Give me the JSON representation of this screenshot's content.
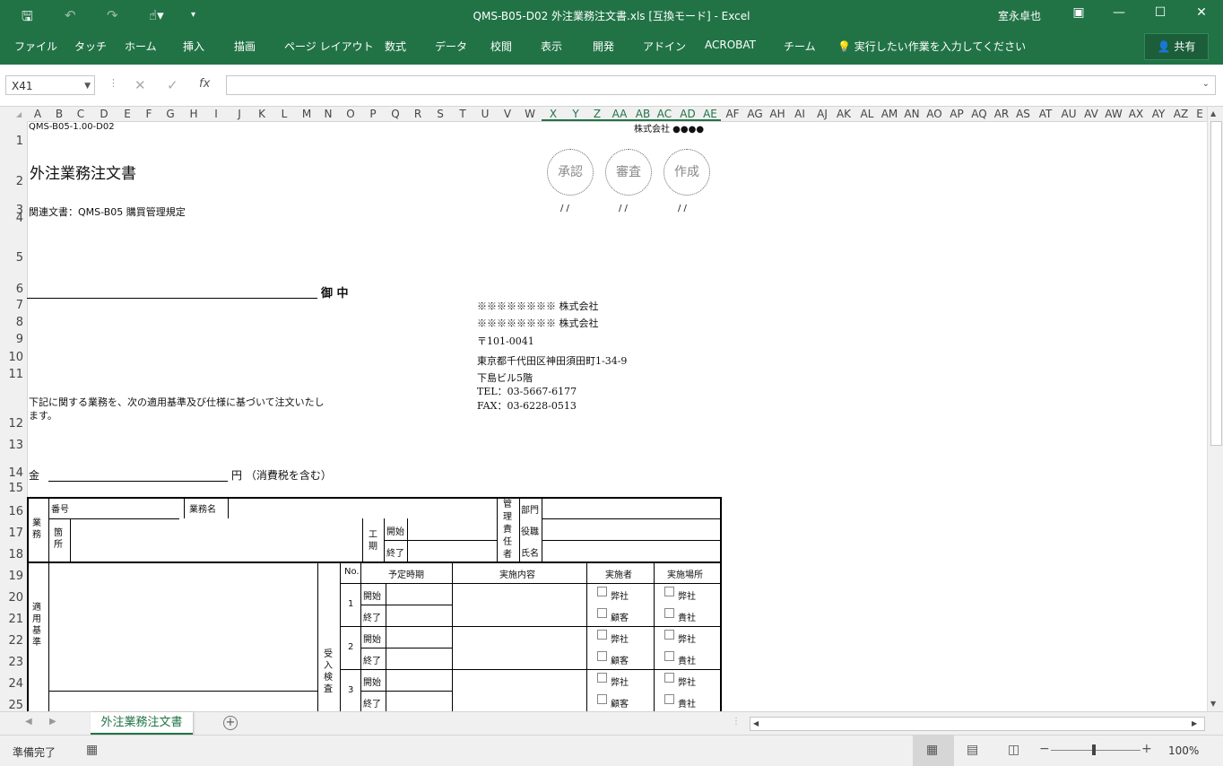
{
  "window": {
    "title": "QMS-B05-D02 外注業務注文書.xls  [互換モード] - Excel",
    "user": "室永卓也"
  },
  "quick_access": [
    "save-icon",
    "undo-icon",
    "redo-icon",
    "touch-mode-icon",
    "customize-icon"
  ],
  "ribbon": {
    "tabs": [
      "ファイル",
      "タッチ",
      "ホーム",
      "挿入",
      "描画",
      "ページ レイアウト",
      "数式",
      "データ",
      "校閲",
      "表示",
      "開発",
      "アドイン",
      "ACROBAT",
      "チーム"
    ],
    "tell_me": "実行したい作業を入力してください",
    "share": "共有"
  },
  "formula_bar": {
    "name_box": "X41",
    "formula": "",
    "fx_label": "fx"
  },
  "columns": [
    "A",
    "B",
    "C",
    "D",
    "E",
    "F",
    "G",
    "H",
    "I",
    "J",
    "K",
    "L",
    "M",
    "N",
    "O",
    "P",
    "Q",
    "R",
    "S",
    "T",
    "U",
    "V",
    "W",
    "X",
    "Y",
    "Z",
    "AA",
    "AB",
    "AC",
    "AD",
    "AE",
    "AF",
    "AG",
    "AH",
    "AI",
    "AJ",
    "AK",
    "AL",
    "AM",
    "AN",
    "AO",
    "AP",
    "AQ",
    "AR",
    "AS",
    "AT",
    "AU",
    "AV",
    "AW",
    "AX",
    "AY",
    "AZ",
    "E"
  ],
  "rows": [
    "1",
    "2",
    "3",
    "4",
    "5",
    "6",
    "7",
    "8",
    "9",
    "10",
    "11",
    "12",
    "13",
    "14",
    "15",
    "16",
    "17",
    "18",
    "19",
    "20",
    "21",
    "22",
    "23",
    "24",
    "25"
  ],
  "doc": {
    "code": "QMS-B05-1.00-D02",
    "company_top": "株式会社 ●●●●",
    "title": "外注業務注文書",
    "related": "関連文書：QMS-B05 購買管理規定",
    "seals": [
      "承認",
      "審査",
      "作成"
    ],
    "seal_date": "/  /",
    "onchu": "御 中",
    "sender": {
      "company1": "※※※※※※※※ 株式会社",
      "company2": "※※※※※※※※ 株式会社",
      "postal": "〒101-0041",
      "address": "東京都千代田区神田須田町1-34-9",
      "building": "下島ビル5階",
      "tel": "TEL：03-5667-6177",
      "fax": "FAX：03-6228-0513"
    },
    "intro1": "下記に関する業務を、次の適用基準及び仕様に基づいて注文いたし",
    "intro2": "ます。",
    "amount_prefix": "金",
    "amount_suffix": "円 （消費税を含む）",
    "table": {
      "gyomu": "業務",
      "bango": "番号",
      "gyomumei": "業務名",
      "kasho": "箇所",
      "koki": "工期",
      "kaishi": "開始",
      "shuryo": "終了",
      "kanri": "管理責任者",
      "bumon": "部門",
      "yakushoku": "役職",
      "shimei": "氏名",
      "tekiyo": "適用基準",
      "ukeire": "受入検査",
      "col_no": "No.",
      "col_yotei": "予定時期",
      "col_naiyo": "実施内容",
      "col_jisshisha": "実施者",
      "col_basho": "実施場所",
      "rows": [
        "1",
        "2",
        "3"
      ],
      "opt_heisha": "弊社",
      "opt_kokyaku": "顧客",
      "opt_kisha": "貴社"
    }
  },
  "sheet_tab": "外注業務注文書",
  "status": {
    "ready": "準備完了",
    "zoom": "100%"
  }
}
